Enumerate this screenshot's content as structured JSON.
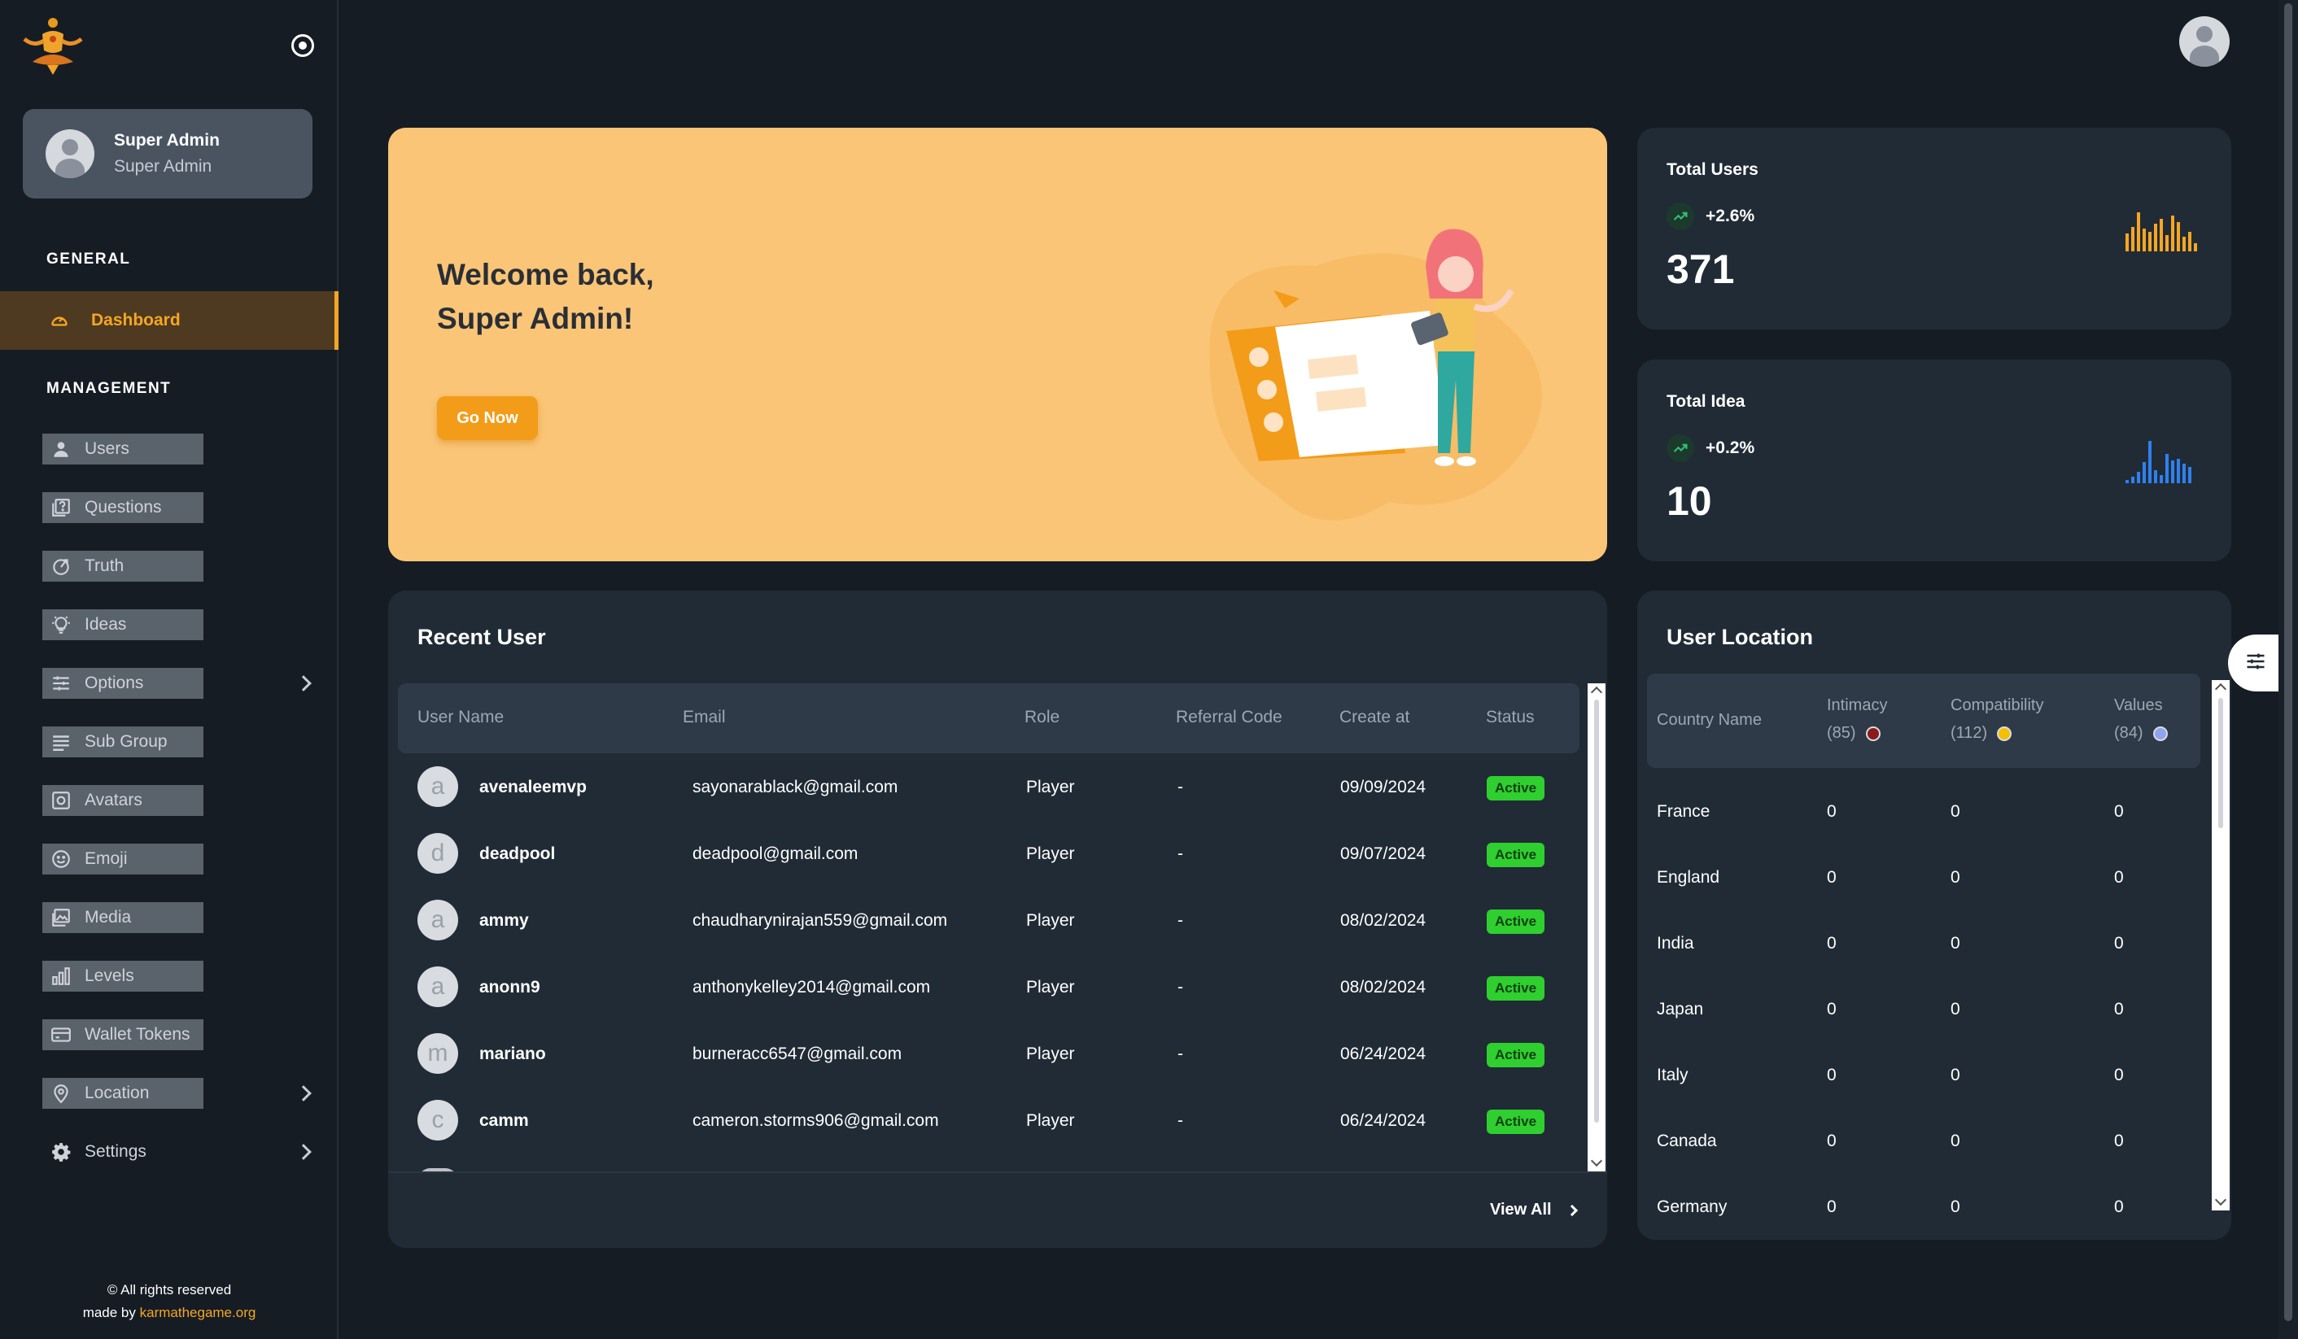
{
  "sidebar": {
    "profile": {
      "name": "Super Admin",
      "role": "Super Admin"
    },
    "general_title": "GENERAL",
    "dashboard_label": "Dashboard",
    "management_title": "MANAGEMENT",
    "items": [
      {
        "label": "Users",
        "icon": "user-icon"
      },
      {
        "label": "Questions",
        "icon": "question-icon"
      },
      {
        "label": "Truth",
        "icon": "truth-icon"
      },
      {
        "label": "Ideas",
        "icon": "lightbulb-icon"
      },
      {
        "label": "Options",
        "icon": "sliders-icon"
      },
      {
        "label": "Sub Group",
        "icon": "list-icon"
      },
      {
        "label": "Avatars",
        "icon": "camera-icon"
      },
      {
        "label": "Emoji",
        "icon": "emoji-icon"
      },
      {
        "label": "Media",
        "icon": "image-icon"
      },
      {
        "label": "Levels",
        "icon": "bar-chart-icon"
      },
      {
        "label": "Wallet Tokens",
        "icon": "wallet-icon"
      },
      {
        "label": "Location",
        "icon": "location-pin-icon"
      },
      {
        "label": "Settings",
        "icon": "gear-icon"
      }
    ],
    "footer": {
      "rights": "© All rights reserved",
      "made_by": "made by",
      "link": "karmathegame.org"
    }
  },
  "banner": {
    "title_line1": "Welcome back,",
    "title_line2": "Super Admin!",
    "button_label": "Go Now"
  },
  "stats": {
    "total_users": {
      "title": "Total Users",
      "trend": "+2.6%",
      "value": "371",
      "color": "#f5a623"
    },
    "total_idea": {
      "title": "Total Idea",
      "trend": "+0.2%",
      "value": "10",
      "color": "#2f80ed"
    }
  },
  "recent_user": {
    "title": "Recent User",
    "columns": [
      "User Name",
      "Email",
      "Role",
      "Referral Code",
      "Create at",
      "Status"
    ],
    "rows": [
      {
        "initial": "a",
        "name": "avenaleemvp",
        "email": "sayonarablack@gmail.com",
        "role": "Player",
        "referral": "-",
        "created": "09/09/2024",
        "status": "Active"
      },
      {
        "initial": "d",
        "name": "deadpool",
        "email": "deadpool@gmail.com",
        "role": "Player",
        "referral": "-",
        "created": "09/07/2024",
        "status": "Active"
      },
      {
        "initial": "a",
        "name": "ammy",
        "email": "chaudharynirajan559@gmail.com",
        "role": "Player",
        "referral": "-",
        "created": "08/02/2024",
        "status": "Active"
      },
      {
        "initial": "a",
        "name": "anonn9",
        "email": "anthonykelley2014@gmail.com",
        "role": "Player",
        "referral": "-",
        "created": "08/02/2024",
        "status": "Active"
      },
      {
        "initial": "m",
        "name": "mariano",
        "email": "burneracc6547@gmail.com",
        "role": "Player",
        "referral": "-",
        "created": "06/24/2024",
        "status": "Active"
      },
      {
        "initial": "c",
        "name": "camm",
        "email": "cameron.storms906@gmail.com",
        "role": "Player",
        "referral": "-",
        "created": "06/24/2024",
        "status": "Active"
      }
    ],
    "view_all": "View All"
  },
  "user_location": {
    "title": "User Location",
    "country_header": "Country Name",
    "intimacy_label": "Intimacy",
    "intimacy_count": "(85)",
    "intimacy_color": "#8b1a1a",
    "compatibility_label": "Compatibility",
    "compatibility_count": "(112)",
    "compatibility_color": "#f5c000",
    "values_label": "Values",
    "values_count": "(84)",
    "values_color": "#8fa4f0",
    "rows": [
      {
        "country": "France",
        "intimacy": "0",
        "compatibility": "0",
        "values": "0"
      },
      {
        "country": "England",
        "intimacy": "0",
        "compatibility": "0",
        "values": "0"
      },
      {
        "country": "India",
        "intimacy": "0",
        "compatibility": "0",
        "values": "0"
      },
      {
        "country": "Japan",
        "intimacy": "0",
        "compatibility": "0",
        "values": "0"
      },
      {
        "country": "Italy",
        "intimacy": "0",
        "compatibility": "0",
        "values": "0"
      },
      {
        "country": "Canada",
        "intimacy": "0",
        "compatibility": "0",
        "values": "0"
      },
      {
        "country": "Germany",
        "intimacy": "0",
        "compatibility": "0",
        "values": "0"
      }
    ]
  }
}
